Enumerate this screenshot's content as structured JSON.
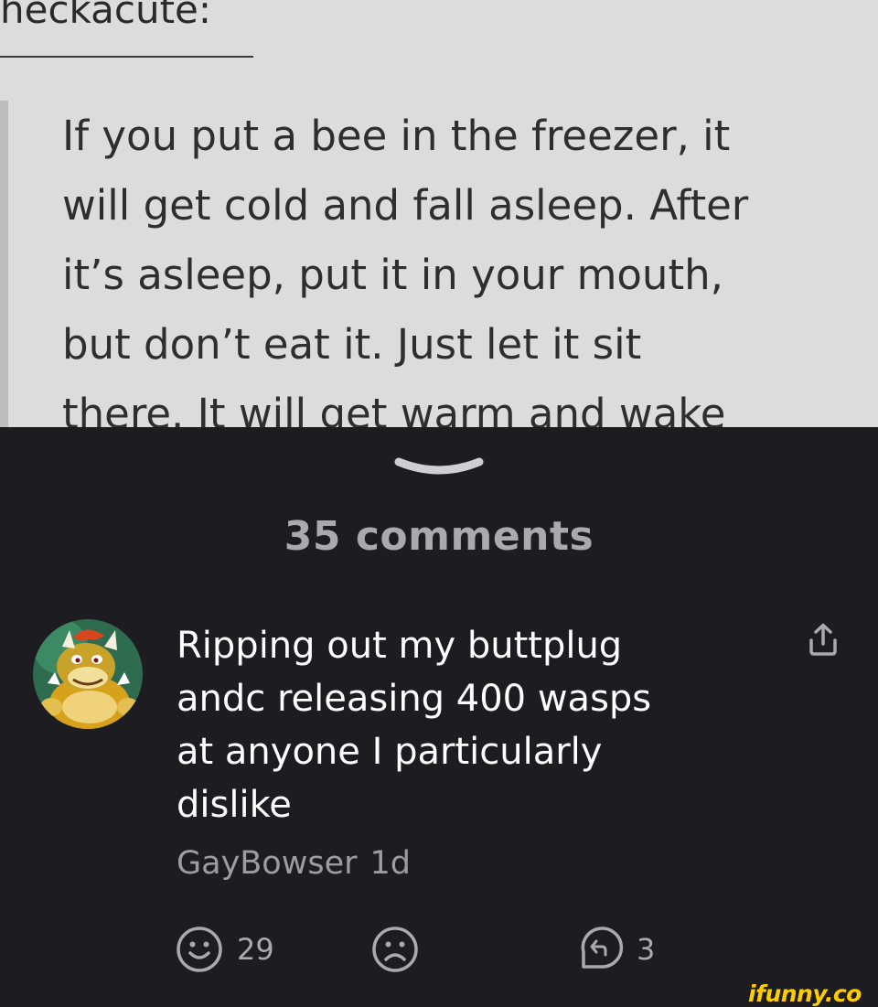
{
  "post": {
    "username": "heckacute:",
    "lines": [
      "If you put a bee in the freezer, it",
      "will get cold and fall asleep. After",
      "it’s asleep, put it in your mouth,",
      "but don’t eat it. Just let it sit",
      "there. It will get warm and wake"
    ]
  },
  "comments_header": {
    "count_label": "35 comments"
  },
  "comment": {
    "lines": [
      "Ripping out my buttplug",
      "andc releasing 400 wasps",
      "at anyone I particularly",
      "dislike"
    ],
    "author": "GayBowser",
    "time": "1d",
    "smiles": "29",
    "replies": "3",
    "icons": [
      "share-icon",
      "smile-icon",
      "frown-icon",
      "reply-icon"
    ]
  },
  "watermark": "ifunny.co",
  "colors": {
    "sheet_background": "#1c1c21",
    "post_background": "#dcdcdc",
    "comment_text": "#ffffff",
    "muted_text": "#9c9ca2",
    "watermark": "#ffcc00"
  }
}
